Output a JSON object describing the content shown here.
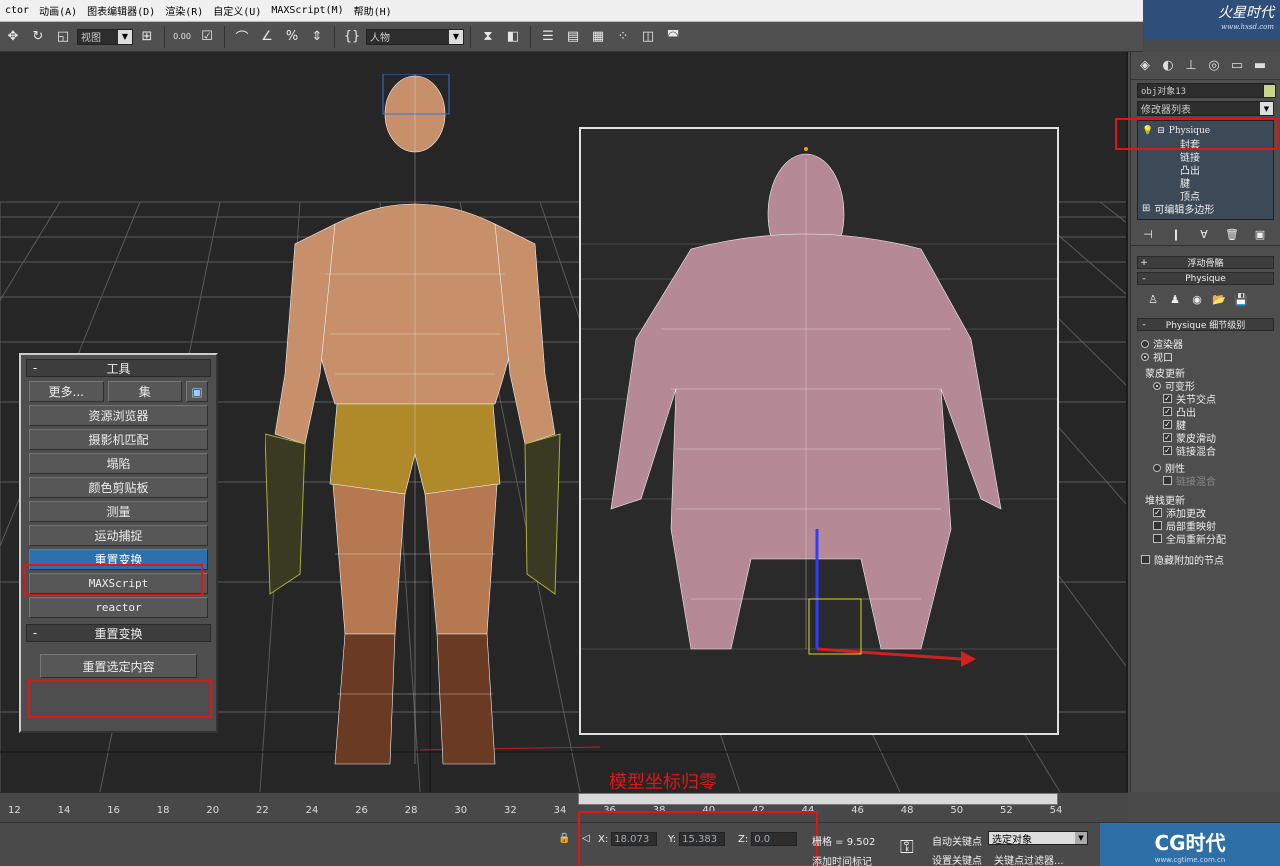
{
  "menubar": {
    "items": [
      "ctor",
      "动画(A)",
      "图表编辑器(D)",
      "渲染(R)",
      "自定义(U)",
      "MAXScript(M)",
      "帮助(H)"
    ]
  },
  "watermark_top": {
    "logo": "火星时代",
    "url": "www.hxsd.com"
  },
  "toolbar": {
    "view_select": "视图",
    "snap_value": "0.00",
    "named_selection": "人物"
  },
  "tools_panel": {
    "title": "工具",
    "more_label": "更多...",
    "sets_label": "集",
    "buttons": [
      "资源浏览器",
      "摄影机匹配",
      "塌陷",
      "颜色剪贴板",
      "测量",
      "运动捕捉",
      "重置变换",
      "MAXScript",
      "reactor"
    ],
    "selected_button": "重置变换",
    "reset_rollout_title": "重置变换",
    "reset_selected_label": "重置选定内容"
  },
  "command_panel": {
    "object_name": "obj对象13",
    "modifier_list": "修改器列表",
    "stack": {
      "root": "Physique",
      "children": [
        "封套",
        "链接",
        "凸出",
        "腱",
        "顶点"
      ],
      "base": "可编辑多边形"
    },
    "rollouts": {
      "float_bones": "浮动骨骼",
      "physique": "Physique",
      "level_of_detail": "Physique 细节级别"
    },
    "lod": {
      "renderer": "渲染器",
      "viewport": "视口",
      "skin_update": "蒙皮更新",
      "deformable": "可变形",
      "joint_intersections": "关节交点",
      "bulge": "凸出",
      "tendon": "腱",
      "skin_sliding": "蒙皮滑动",
      "link_blending": "链接混合",
      "rigid": "刚性",
      "rigid_link_blending": "链接混合",
      "stack_update": "堆栈更新",
      "add_changes": "添加更改",
      "local_remap": "局部重映射",
      "global_redistribute": "全局重新分配",
      "hide_attached_nodes": "隐藏附加的节点"
    }
  },
  "annotation": {
    "text": "模型坐标归零"
  },
  "timeline": {
    "ticks": [
      "12",
      "14",
      "16",
      "18",
      "20",
      "22",
      "24",
      "26",
      "28",
      "30",
      "32",
      "34",
      "36",
      "38",
      "40",
      "42",
      "44",
      "46",
      "48",
      "50",
      "52",
      "54"
    ]
  },
  "statusbar": {
    "x_label": "X:",
    "x_value": "18.073",
    "y_label": "Y:",
    "y_value": "15.383",
    "z_label": "Z:",
    "z_value": "0.0",
    "grid": "栅格 = 9.502",
    "add_time_tag": "添加时间标记",
    "auto_key": "自动关键点",
    "set_key": "设置关键点",
    "selected_object": "选定对象",
    "key_filters": "关键点过滤器..."
  },
  "watermark_bottom": {
    "logo": "CG时代",
    "url": "www.cgtime.com.cn"
  },
  "colors": {
    "selected_blue": "#2e6fae",
    "annotation_red": "#e01515",
    "viewport_bg": "#262626"
  }
}
